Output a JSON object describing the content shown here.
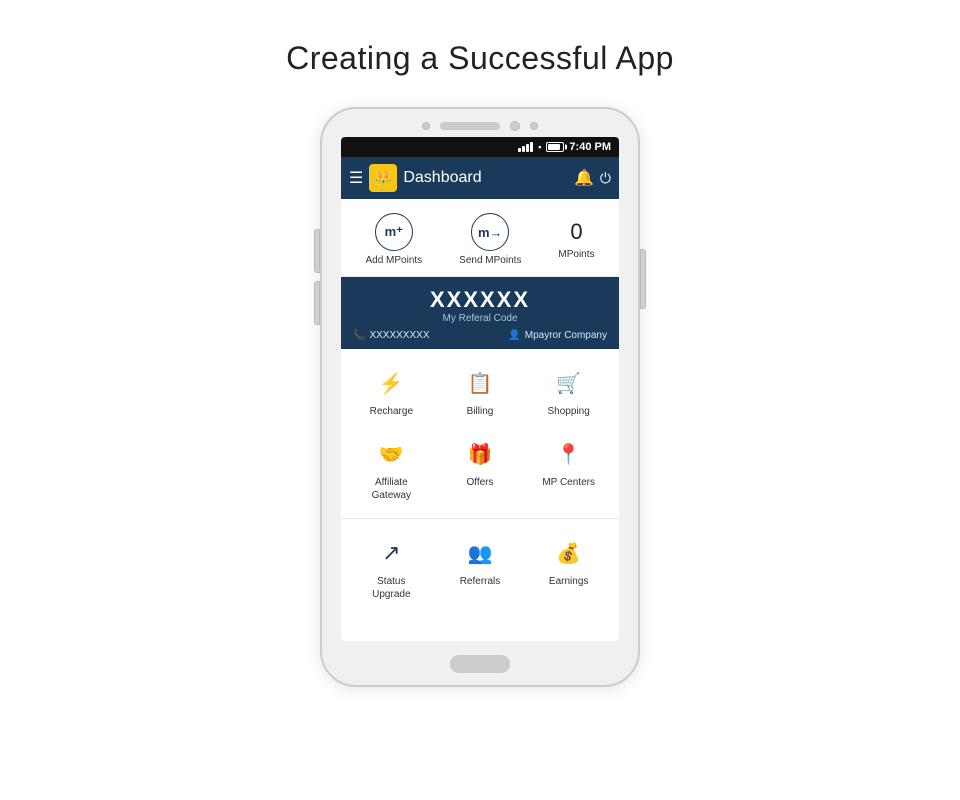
{
  "page": {
    "title": "Creating a Successful App"
  },
  "status_bar": {
    "time": "7:40 PM"
  },
  "app_bar": {
    "title": "Dashboard",
    "logo_symbol": "₵",
    "hamburger": "☰",
    "bell": "🔔",
    "power": "⏻"
  },
  "mpoints": {
    "add_label": "Add MPoints",
    "send_label": "Send MPoints",
    "count": "0",
    "count_label": "MPoints"
  },
  "referral": {
    "code": "XXXXXX",
    "sub_label": "My Referal Code",
    "phone": "XXXXXXXXX",
    "company": "Mpayror Company"
  },
  "menu_items": [
    {
      "id": "recharge",
      "label": "Recharge",
      "icon": "⚡"
    },
    {
      "id": "billing",
      "label": "Billing",
      "icon": "🧾"
    },
    {
      "id": "shopping",
      "label": "Shopping",
      "icon": "🛒"
    },
    {
      "id": "affiliate",
      "label": "Affiliate\nGateway",
      "icon": "🤝"
    },
    {
      "id": "offers",
      "label": "Offers",
      "icon": "🎁"
    },
    {
      "id": "mpcenters",
      "label": "MP Centers",
      "icon": "📍"
    }
  ],
  "bottom_items": [
    {
      "id": "status",
      "label": "Status\nUpgrade",
      "icon": "↗"
    },
    {
      "id": "referrals",
      "label": "Referrals",
      "icon": "👥"
    },
    {
      "id": "earnings",
      "label": "Earnings",
      "icon": "💰"
    }
  ]
}
